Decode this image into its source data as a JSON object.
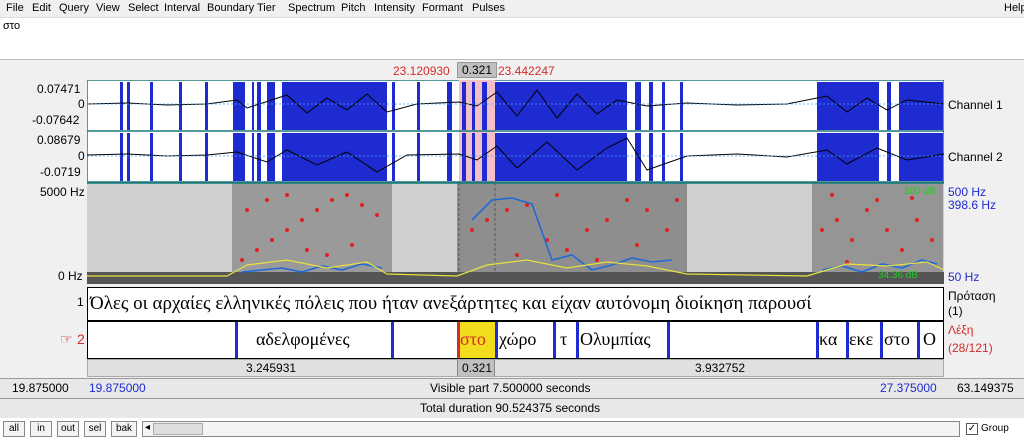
{
  "menu": [
    "File",
    "Edit",
    "Query",
    "View",
    "Select",
    "Interval",
    "Boundary",
    "Tier",
    "Spectrum",
    "Pitch",
    "Intensity",
    "Formant",
    "Pulses"
  ],
  "menu_help": "Help",
  "text_field": "στο",
  "selection": {
    "start": "23.120930",
    "dur": "0.321",
    "end": "23.442247"
  },
  "channel1": {
    "max": "0.07471",
    "zero": "0",
    "min": "-0.07642",
    "label": "Channel 1"
  },
  "channel2": {
    "max": "0.08679",
    "zero": "0",
    "min": "-0.0719",
    "label": "Channel 2"
  },
  "spectrogram": {
    "top": "5000 Hz",
    "bottom": "0 Hz",
    "right_top": "500 Hz",
    "right_mid": "398.6 Hz",
    "right_bottom": "50 Hz",
    "corner_top": "100 dB",
    "corner_bottom": "34.36 dB"
  },
  "tier1": {
    "num": "1",
    "text": "Όλες οι αρχαίες ελληνικές πόλεις που ήταν ανεξάρτητες και είχαν αυτόνομη διοίκηση παρουσί",
    "name": "Πρόταση",
    "count": "(1)"
  },
  "tier2": {
    "num": "2",
    "name": "Λέξη",
    "count": "(28/121)",
    "words": [
      "αδελφομένες",
      "στο",
      "χώρο",
      "τ",
      "Ολυμπίας",
      "κα",
      "εκε",
      "στο",
      "Ο"
    ]
  },
  "durations": [
    "3.245931",
    "0.321",
    "3.932752"
  ],
  "time_bar": {
    "left_outer": "19.875000",
    "left_inner": "19.875000",
    "visible": "Visible part 7.500000 seconds",
    "right_inner": "27.375000",
    "right_outer": "63.149375"
  },
  "total": "Total duration 90.524375 seconds",
  "buttons": [
    "all",
    "in",
    "out",
    "sel",
    "bak"
  ],
  "group_label": "Group"
}
